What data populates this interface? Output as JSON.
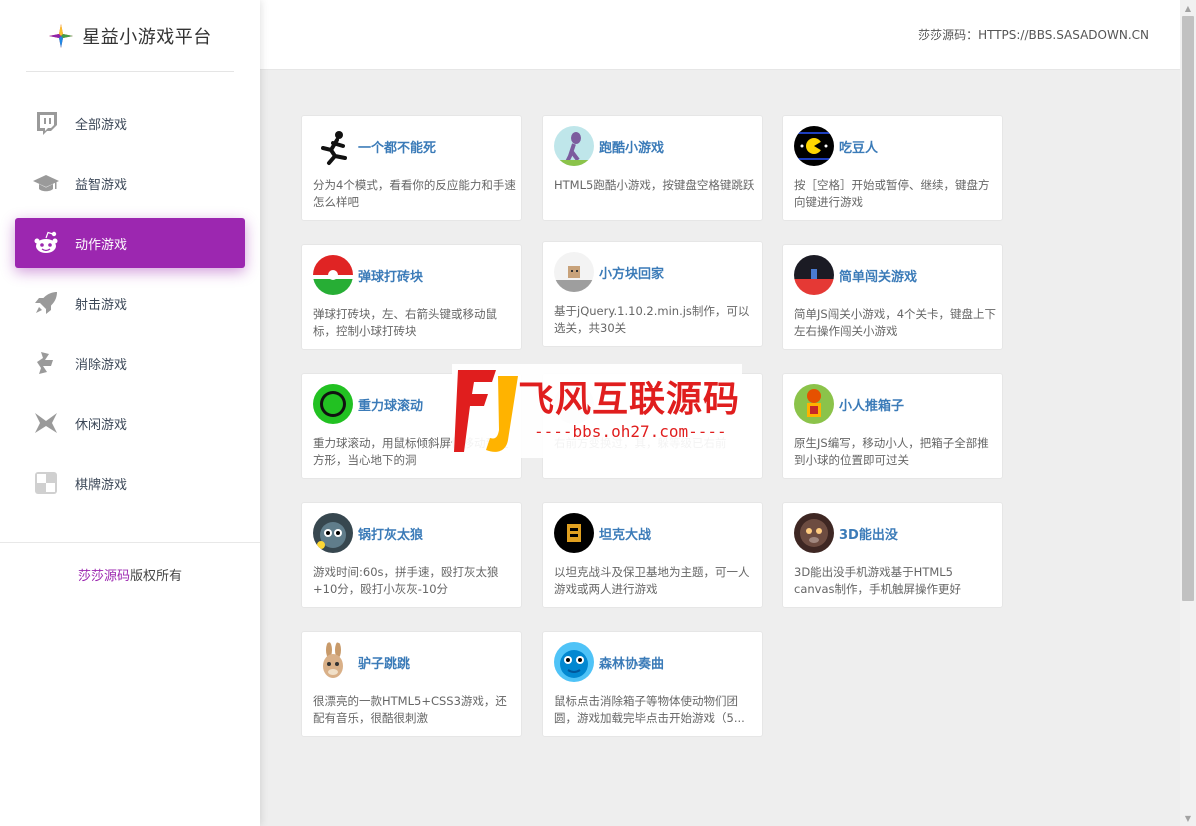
{
  "brand": {
    "title": "星益小游戏平台",
    "icon": "star-logo-icon"
  },
  "topbar": {
    "source_text": "莎莎源码：HTTPS://BBS.SASADOWN.CN"
  },
  "sidebar": {
    "items": [
      {
        "label": "全部游戏",
        "icon": "twitch-icon"
      },
      {
        "label": "益智游戏",
        "icon": "graduation-cap-icon"
      },
      {
        "label": "动作游戏",
        "icon": "reddit-icon",
        "active": true
      },
      {
        "label": "射击游戏",
        "icon": "rocket-icon"
      },
      {
        "label": "消除游戏",
        "icon": "hexagon-icon"
      },
      {
        "label": "休闲游戏",
        "icon": "origami-icon"
      },
      {
        "label": "棋牌游戏",
        "icon": "checker-icon"
      }
    ],
    "footer_link": "莎莎源码",
    "footer_text": "版权所有"
  },
  "games": [
    {
      "title": "一个都不能死",
      "desc": "分为4个模式，看看你的反应能力和手速怎么样吧"
    },
    {
      "title": "跑酷小游戏",
      "desc": "HTML5跑酷小游戏，按键盘空格键跳跃"
    },
    {
      "title": "吃豆人",
      "desc": "按［空格］开始或暂停、继续，键盘方向键进行游戏"
    },
    {
      "title": "弹球打砖块",
      "desc": "弹球打砖块，左、右箭头键或移动鼠标，控制小球打砖块"
    },
    {
      "title": "小方块回家",
      "desc": "基于jQuery.1.10.2.min.js制作，可以选关，共30关"
    },
    {
      "title": "简单闯关游戏",
      "desc": "简单JS闯关小游戏，4个关卡，键盘上下左右操作闯关小游戏"
    },
    {
      "title": "重力球滚动",
      "desc": "重力球滚动，用鼠标倾斜屏体移动到正方形，当心地下的洞"
    },
    {
      "title": "",
      "desc": "右前方变换过，其，躲等级已右前"
    },
    {
      "title": "小人推箱子",
      "desc": "原生JS编写，移动小人，把箱子全部推到小球的位置即可过关"
    },
    {
      "title": "锅打灰太狼",
      "desc": "游戏时间:60s，拼手速，殴打灰太狼+10分，殴打小灰灰-10分"
    },
    {
      "title": "坦克大战",
      "desc": "以坦克战斗及保卫基地为主题，可一人游戏或两人进行游戏"
    },
    {
      "title": "3D能出没",
      "desc": "3D能出没手机游戏基于HTML5 canvas制作，手机触屏操作更好"
    },
    {
      "title": "驴子跳跳",
      "desc": "很漂亮的一款HTML5+CSS3游戏，还配有音乐，很酷很刺激"
    },
    {
      "title": "森林协奏曲",
      "desc": "鼠标点击消除箱子等物体使动物们团圆，游戏加载完毕点击开始游戏（5..."
    }
  ],
  "watermark": {
    "text": "飞风互联源码",
    "url": "----bbs.oh27.com----"
  }
}
